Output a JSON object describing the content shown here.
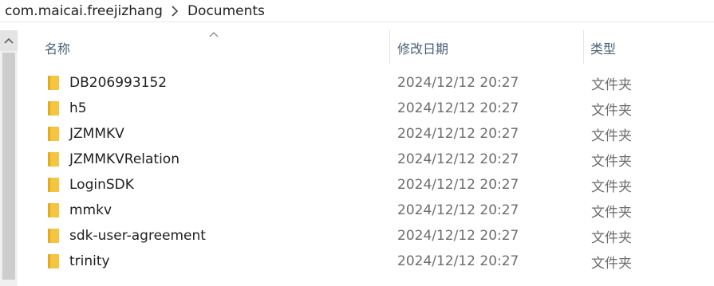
{
  "breadcrumb": {
    "items": [
      {
        "label": "com.maicai.freejizhang"
      },
      {
        "label": "Documents"
      }
    ]
  },
  "columns": {
    "name": "名称",
    "date_modified": "修改日期",
    "type": "类型",
    "sorted_column": "name",
    "sort_direction": "ascending"
  },
  "icons": {
    "folder": "folder-icon",
    "separator": "chevron-right-icon",
    "sort": "sort-up-icon",
    "scroll_up": "scroll-up-arrow-icon"
  },
  "colors": {
    "folder_fill": "#f4c542",
    "folder_shade": "#e5aa17",
    "header_text": "#4c607a",
    "secondary_text": "#6d6d6d"
  },
  "files": [
    {
      "name": "DB206993152",
      "date": "2024/12/12 20:27",
      "type": "文件夹"
    },
    {
      "name": "h5",
      "date": "2024/12/12 20:27",
      "type": "文件夹"
    },
    {
      "name": "JZMMKV",
      "date": "2024/12/12 20:27",
      "type": "文件夹"
    },
    {
      "name": "JZMMKVRelation",
      "date": "2024/12/12 20:27",
      "type": "文件夹"
    },
    {
      "name": "LoginSDK",
      "date": "2024/12/12 20:27",
      "type": "文件夹"
    },
    {
      "name": "mmkv",
      "date": "2024/12/12 20:27",
      "type": "文件夹"
    },
    {
      "name": "sdk-user-agreement",
      "date": "2024/12/12 20:27",
      "type": "文件夹"
    },
    {
      "name": "trinity",
      "date": "2024/12/12 20:27",
      "type": "文件夹"
    }
  ]
}
